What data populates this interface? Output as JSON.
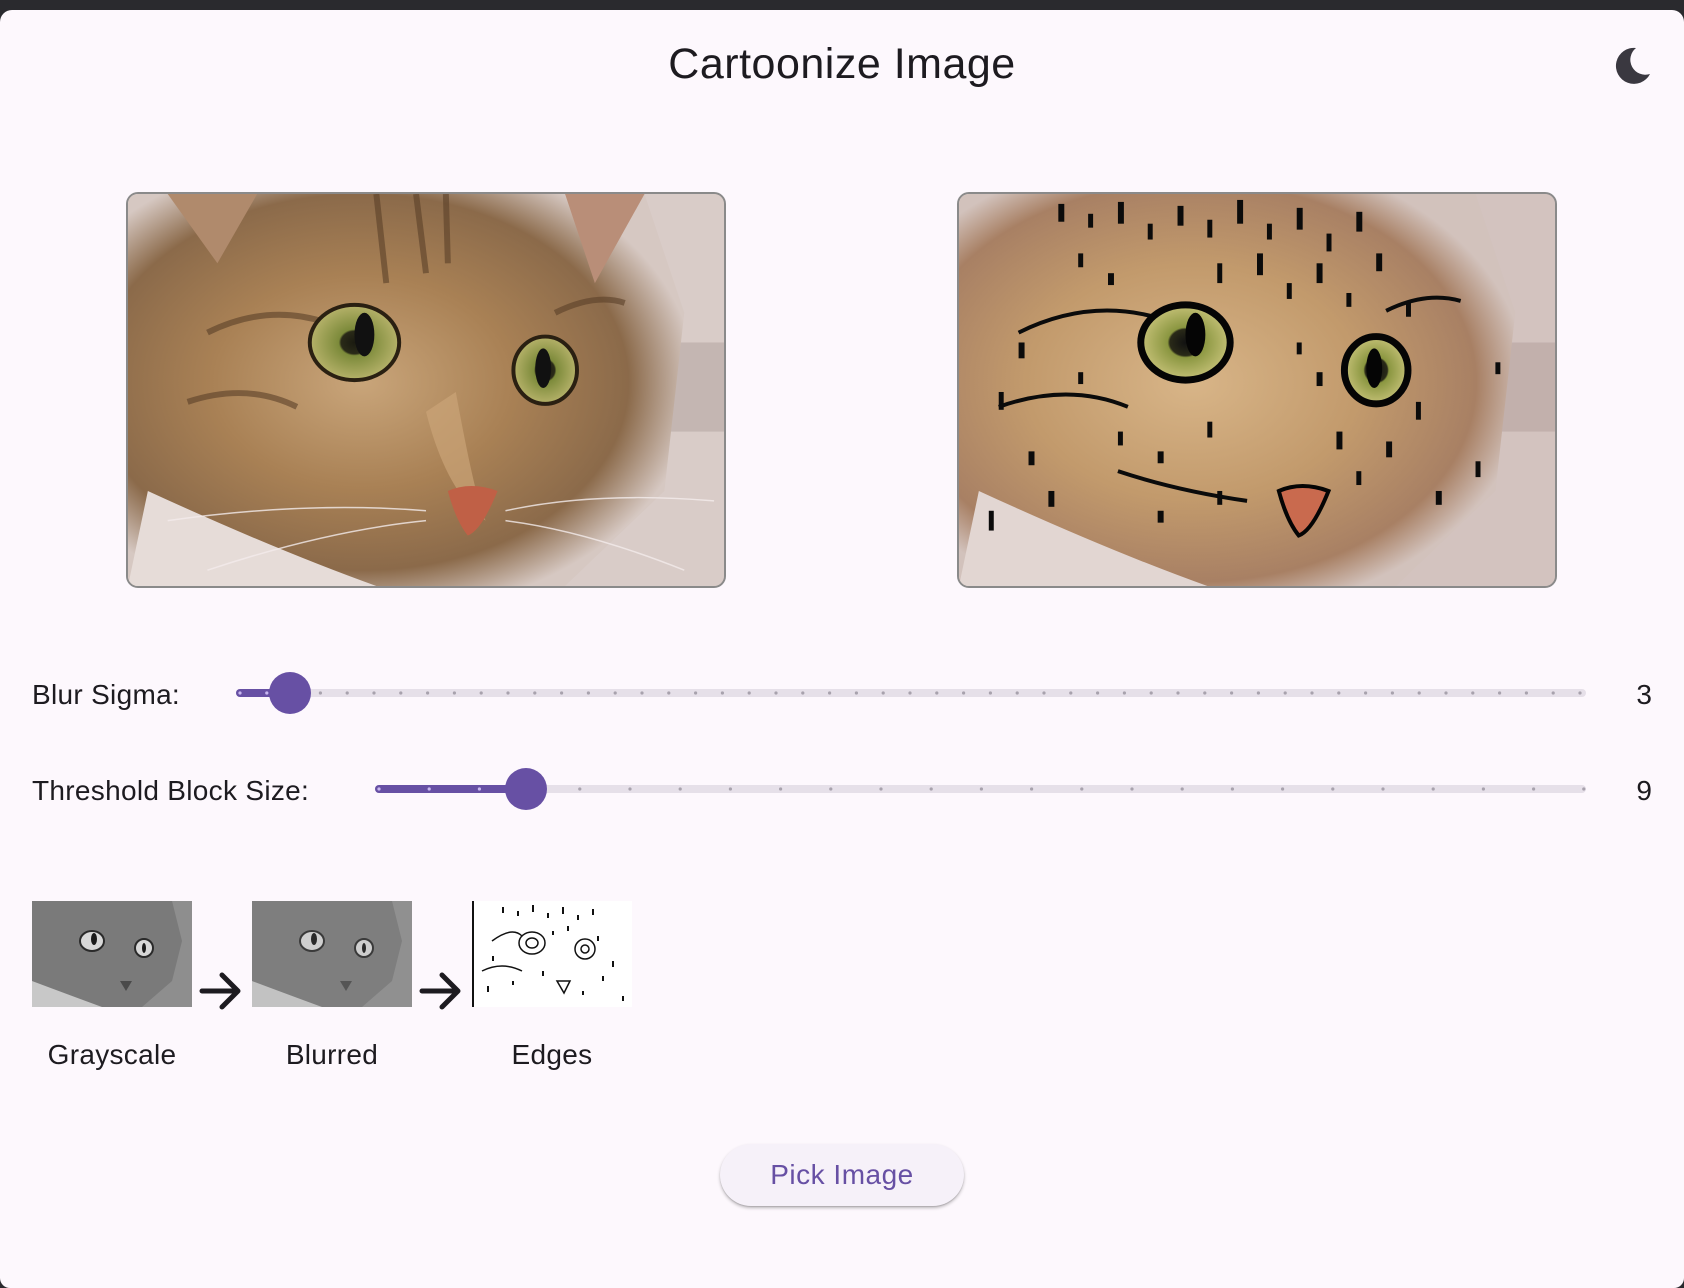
{
  "app": {
    "title": "Cartoonize Image",
    "theme_icon": "moon-icon"
  },
  "images": {
    "original": {
      "icon": "cat-photo-original"
    },
    "cartoon": {
      "icon": "cat-photo-cartoonized"
    }
  },
  "controls": {
    "blur": {
      "label": "Blur Sigma:",
      "value": "3",
      "fill_fraction": 0.04
    },
    "threshold": {
      "label": "Threshold Block Size:",
      "value": "9",
      "fill_fraction": 0.125
    }
  },
  "pipeline": {
    "steps": [
      {
        "label": "Grayscale",
        "icon": "grayscale-thumbnail"
      },
      {
        "label": "Blurred",
        "icon": "blurred-thumbnail"
      },
      {
        "label": "Edges",
        "icon": "edges-thumbnail"
      }
    ],
    "arrow_icon": "arrow-right-icon"
  },
  "actions": {
    "pick_image_label": "Pick Image"
  },
  "colors": {
    "accent": "#6750a4",
    "track": "#e6e0e9",
    "background": "#fdf8fd",
    "text": "#1d1b20"
  }
}
